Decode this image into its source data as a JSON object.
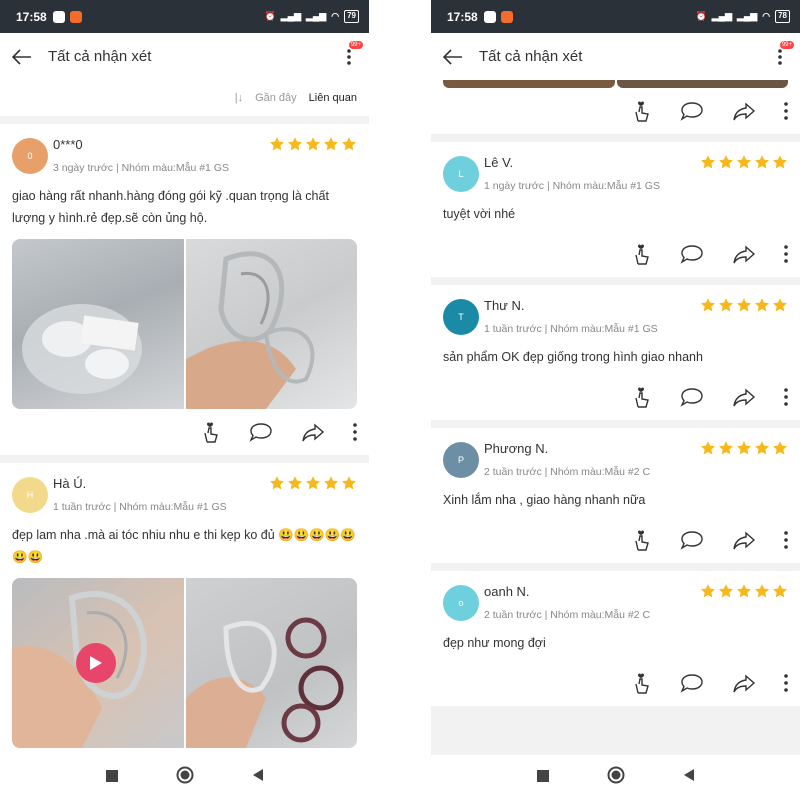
{
  "screens": [
    {
      "status": {
        "time": "17:58",
        "battery": "79"
      },
      "header": {
        "title": "Tất cả nhận xét",
        "badge": "99+"
      },
      "sort": {
        "recent": "Gần đây",
        "relevant": "Liên quan"
      },
      "reviews": [
        {
          "avatar_letter": "0",
          "avatar_color": "#e8a06a",
          "name": "0***0",
          "meta": "3 ngày trước | Nhóm màu:Mẫu #1 GS",
          "rating": 5,
          "text": "giao hàng rất nhanh.hàng đóng gói kỹ .quan trọng là chất lượng y hình.rẻ đẹp.sẽ còn ủng hộ."
        },
        {
          "avatar_letter": "H",
          "avatar_color": "#f2d98c",
          "name": "Hà Ú.",
          "meta": "1 tuần trước | Nhóm màu:Mẫu #1 GS",
          "rating": 5,
          "text": "đẹp lam nha .mà ai tóc nhiu nhu e thi kẹp ko đủ 😃😃😃😃😃😃😃"
        }
      ]
    },
    {
      "status": {
        "time": "17:58",
        "battery": "78"
      },
      "header": {
        "title": "Tất cả nhận xét",
        "badge": "99+"
      },
      "reviews": [
        {
          "avatar_letter": "L",
          "avatar_color": "#6ed0dc",
          "name": "Lê V.",
          "meta": "1 ngày trước | Nhóm màu:Mẫu #1 GS",
          "rating": 5,
          "text": "tuyệt vời nhé"
        },
        {
          "avatar_letter": "T",
          "avatar_color": "#1a8aa6",
          "name": "Thư N.",
          "meta": "1 tuần trước | Nhóm màu:Mẫu #1 GS",
          "rating": 5,
          "text": "sản  phẩm OK đẹp giống  trong hình giao nhanh"
        },
        {
          "avatar_letter": "P",
          "avatar_color": "#6d8fa6",
          "name": "Phương N.",
          "meta": "2 tuần trước | Nhóm màu:Mẫu #2 C",
          "rating": 5,
          "text": "Xinh lắm nha , giao hàng nhanh nữa"
        },
        {
          "avatar_letter": "o",
          "avatar_color": "#6ed0dc",
          "name": "oanh N.",
          "meta": "2 tuần trước | Nhóm màu:Mẫu #2 C",
          "rating": 5,
          "text": "đẹp như mong đợi"
        }
      ]
    }
  ],
  "colors": {
    "star": "#f7b81b",
    "statusbar": "#2a3138",
    "accent_badge": "#ff4444"
  }
}
